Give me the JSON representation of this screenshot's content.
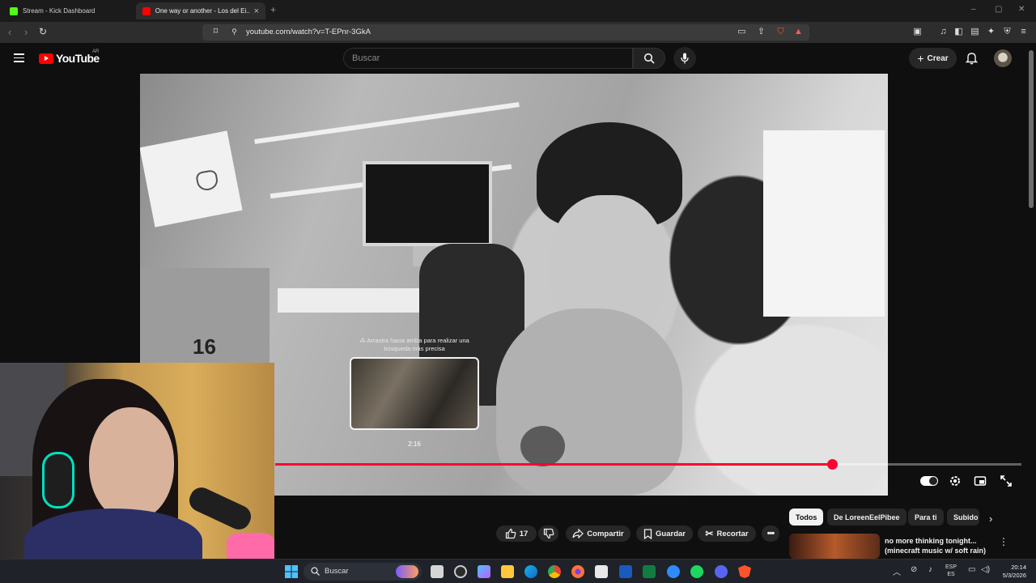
{
  "browser": {
    "tabs": [
      {
        "title": "Stream - Kick Dashboard",
        "favicon_color": "#53fc18"
      },
      {
        "title": "One way or another - Los del Ei...",
        "favicon_color": "#ff0000"
      }
    ],
    "url": "youtube.com/watch?v=T-EPnr-3GkA"
  },
  "youtube": {
    "logo_text": "YouTube",
    "country_code": "AR",
    "search_placeholder": "Buscar",
    "create_label": "Crear"
  },
  "player": {
    "drag_hint": "Arrastra hacia arriba para realizar una búsqueda más precisa",
    "preview_time": "2:16",
    "progress_fraction": 0.746,
    "preview_fraction": 0.195,
    "cabinet_number": "16",
    "accent_color": "#ff0033"
  },
  "actions": {
    "like_count": "17",
    "share_label": "Compartir",
    "save_label": "Guardar",
    "clip_label": "Recortar"
  },
  "chips": [
    "Todos",
    "De LoreenEelPibee",
    "Para ti",
    "Subido"
  ],
  "recommendation": {
    "title": "no more thinking tonight... (minecraft music w/ soft rain)"
  },
  "taskbar": {
    "search_label": "Buscar",
    "lang_line1": "ESP",
    "lang_line2": "ES",
    "time": "20:14",
    "date": "5/3/2026"
  }
}
